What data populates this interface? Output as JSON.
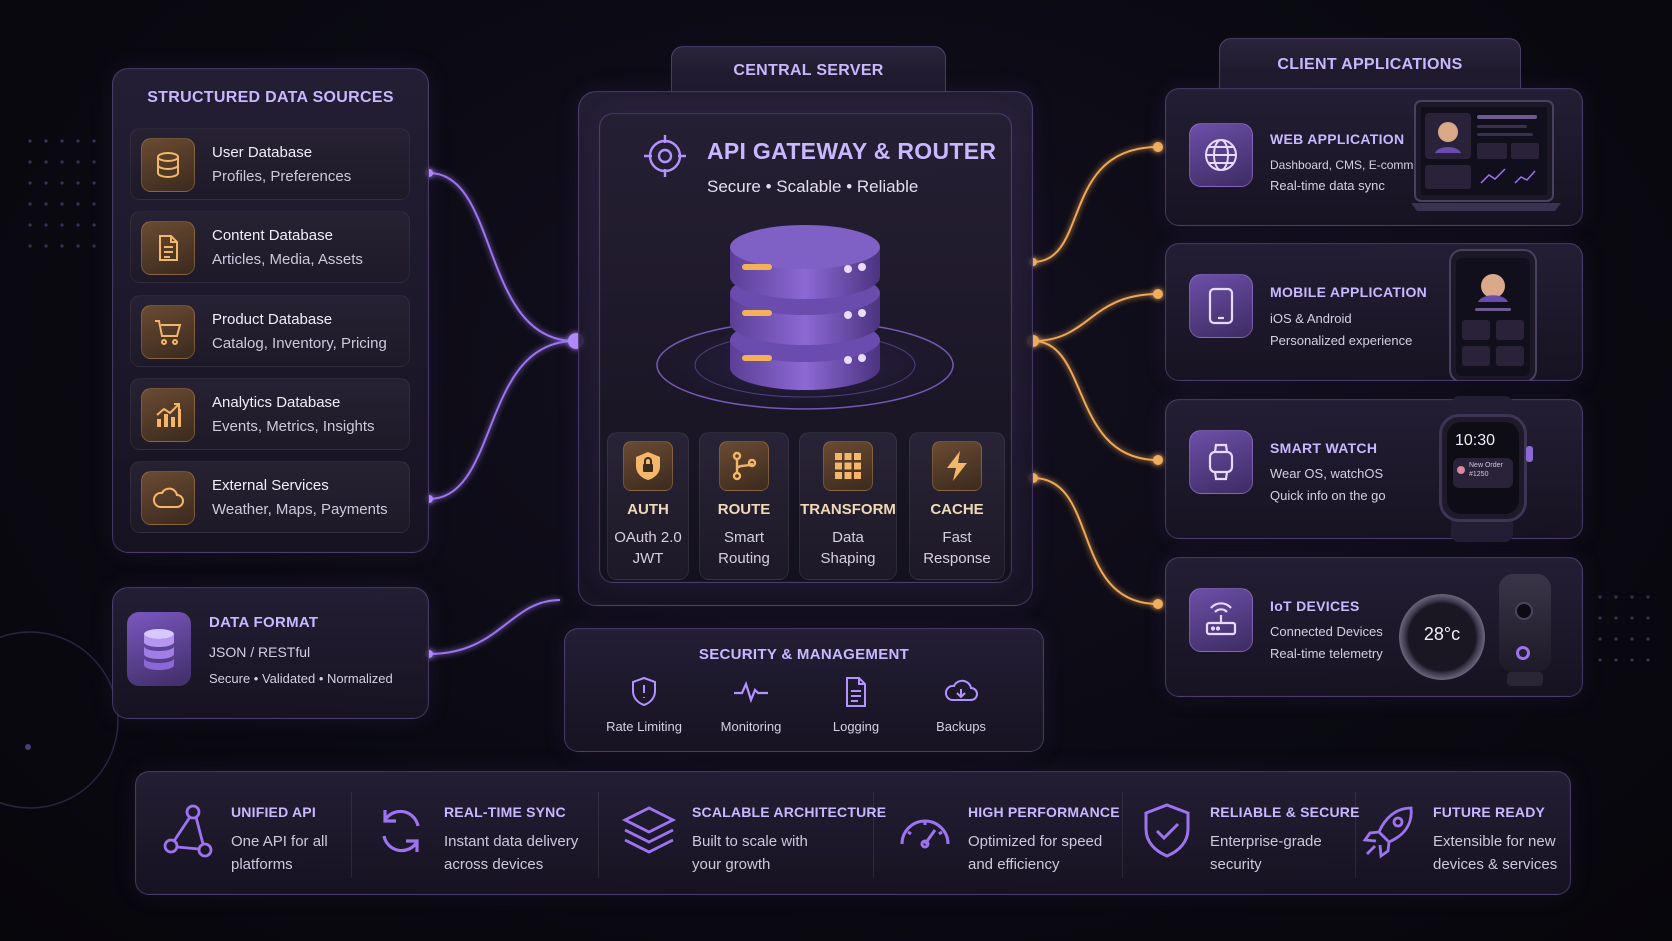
{
  "colors": {
    "accent_purple": "#a67cff",
    "accent_orange": "#f5b15a",
    "background": "#0b0a12"
  },
  "sources": {
    "title": "STRUCTURED DATA SOURCES",
    "items": [
      {
        "icon": "database-icon",
        "title": "User Database",
        "subtitle": "Profiles, Preferences"
      },
      {
        "icon": "document-icon",
        "title": "Content Database",
        "subtitle": "Articles, Media, Assets"
      },
      {
        "icon": "cart-icon",
        "title": "Product Database",
        "subtitle": "Catalog, Inventory, Pricing"
      },
      {
        "icon": "chart-icon",
        "title": "Analytics Database",
        "subtitle": "Events, Metrics, Insights"
      },
      {
        "icon": "cloud-icon",
        "title": "External Services",
        "subtitle": "Weather, Maps, Payments"
      }
    ]
  },
  "data_format": {
    "title": "DATA FORMAT",
    "line1": "JSON / RESTful",
    "line2": "Secure • Validated • Normalized"
  },
  "central": {
    "tab": "CENTRAL SERVER",
    "title": "API GATEWAY & ROUTER",
    "subtitle": "Secure • Scalable • Reliable",
    "modules": [
      {
        "icon": "shield-lock-icon",
        "title": "AUTH",
        "line1": "OAuth 2.0",
        "line2": "JWT"
      },
      {
        "icon": "route-icon",
        "title": "ROUTE",
        "line1": "Smart",
        "line2": "Routing"
      },
      {
        "icon": "grid-icon",
        "title": "TRANSFORM",
        "line1": "Data",
        "line2": "Shaping"
      },
      {
        "icon": "lightning-icon",
        "title": "CACHE",
        "line1": "Fast",
        "line2": "Response"
      }
    ]
  },
  "security": {
    "title": "SECURITY & MANAGEMENT",
    "items": [
      {
        "icon": "shield-icon",
        "label": "Rate Limiting"
      },
      {
        "icon": "pulse-icon",
        "label": "Monitoring"
      },
      {
        "icon": "log-icon",
        "label": "Logging"
      },
      {
        "icon": "cloud-backup-icon",
        "label": "Backups"
      }
    ]
  },
  "clients": {
    "tab": "CLIENT APPLICATIONS",
    "items": [
      {
        "icon": "globe-icon",
        "title": "WEB APPLICATION",
        "line1": "Dashboard, CMS, E-commerce",
        "line2": "Real-time data sync"
      },
      {
        "icon": "phone-icon",
        "title": "MOBILE APPLICATION",
        "line1": "iOS & Android",
        "line2": "Personalized experience"
      },
      {
        "icon": "watch-icon",
        "title": "SMART WATCH",
        "line1": "Wear OS, watchOS",
        "line2": "Quick info on the go"
      },
      {
        "icon": "router-icon",
        "title": "IoT DEVICES",
        "line1": "Connected Devices",
        "line2": "Real-time telemetry"
      }
    ],
    "watch_time": "10:30",
    "watch_note": "New Order #1250",
    "thermostat": "28°c"
  },
  "features": [
    {
      "icon": "network-icon",
      "title": "UNIFIED API",
      "line1": "One API for all",
      "line2": "platforms"
    },
    {
      "icon": "sync-icon",
      "title": "REAL-TIME SYNC",
      "line1": "Instant data delivery",
      "line2": "across devices"
    },
    {
      "icon": "layers-icon",
      "title": "SCALABLE ARCHITECTURE",
      "line1": "Built to scale with",
      "line2": "your growth"
    },
    {
      "icon": "speedometer-icon",
      "title": "HIGH PERFORMANCE",
      "line1": "Optimized for speed",
      "line2": "and efficiency"
    },
    {
      "icon": "shield-check-icon",
      "title": "RELIABLE & SECURE",
      "line1": "Enterprise-grade",
      "line2": "security"
    },
    {
      "icon": "rocket-icon",
      "title": "FUTURE READY",
      "line1": "Extensible for new",
      "line2": "devices & services"
    }
  ]
}
